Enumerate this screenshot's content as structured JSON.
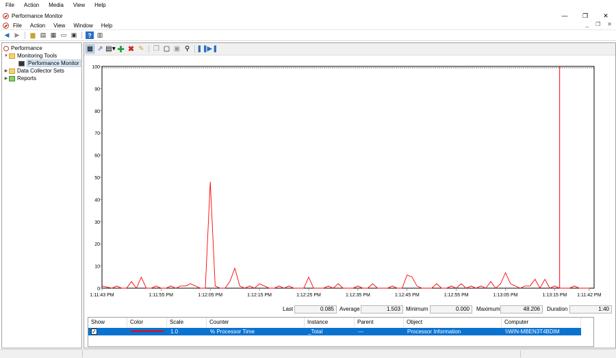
{
  "top_menu": [
    "File",
    "Action",
    "Media",
    "View",
    "Help"
  ],
  "window": {
    "title": "Performance Monitor",
    "controls": [
      "—",
      "❐",
      "✕"
    ]
  },
  "menu": [
    "File",
    "Action",
    "View",
    "Window",
    "Help"
  ],
  "mdi_controls": [
    "_",
    "❐",
    "✕"
  ],
  "tree": {
    "root": "Performance",
    "monitoring_tools": "Monitoring Tools",
    "performance_monitor": "Performance Monitor",
    "data_collector_sets": "Data Collector Sets",
    "reports": "Reports"
  },
  "accent_color": "#ff0000",
  "selection_color": "#0a72d0",
  "chart_data": {
    "type": "line",
    "title": "",
    "ylim": [
      0,
      100
    ],
    "y_ticks": [
      0,
      10,
      20,
      30,
      40,
      50,
      60,
      70,
      80,
      90,
      100
    ],
    "x_tick_labels": [
      "1:11:43 PM",
      "1:11:55 PM",
      "1:12:05 PM",
      "1:12:15 PM",
      "1:12:25 PM",
      "1:12:35 PM",
      "1:12:45 PM",
      "1:12:55 PM",
      "1:13:05 PM",
      "1:13:15 PM",
      "1:11:42 PM"
    ],
    "x_tick_positions_sec": [
      0,
      12,
      22,
      32,
      42,
      52,
      62,
      72,
      82,
      92,
      99
    ],
    "current_time_marker_sec": 93,
    "series": [
      {
        "color": "#ff0000",
        "x_sec": [
          0,
          2,
          3,
          4,
          5,
          6,
          7,
          8,
          9,
          10,
          11,
          12,
          13,
          14,
          15,
          16,
          17,
          18,
          19,
          20,
          21,
          22,
          23,
          24,
          25,
          26,
          27,
          28,
          29,
          30,
          31,
          32,
          33,
          34,
          35,
          36,
          37,
          38,
          39,
          40,
          41,
          42,
          43,
          44,
          45,
          46,
          47,
          48,
          49,
          50,
          51,
          52,
          53,
          54,
          55,
          56,
          57,
          58,
          59,
          60,
          61,
          62,
          63,
          64,
          65,
          66,
          67,
          68,
          69,
          70,
          71,
          72,
          73,
          74,
          75,
          76,
          77,
          78,
          79,
          80,
          81,
          82,
          83,
          84,
          85,
          86,
          87,
          88,
          89,
          90,
          91,
          92,
          93,
          94,
          95,
          96,
          97,
          98,
          99
        ],
        "y": [
          1,
          0,
          1,
          0,
          0,
          3,
          0,
          5,
          0,
          0,
          1,
          0,
          0,
          1,
          0,
          1,
          1,
          2,
          1,
          0,
          0,
          48,
          1,
          0,
          0,
          3,
          9,
          1,
          0,
          1,
          0,
          2,
          1,
          0,
          0,
          1,
          0,
          1,
          0,
          0,
          0,
          5,
          0,
          0,
          0,
          1,
          0,
          2,
          0,
          0,
          0,
          1,
          0,
          0,
          2,
          0,
          0,
          0,
          1,
          0,
          0,
          6,
          5,
          1,
          0,
          0,
          0,
          2,
          0,
          0,
          1,
          0,
          2,
          0,
          1,
          0,
          1,
          0,
          3,
          0,
          2,
          7,
          2,
          1,
          0,
          1,
          1,
          4,
          0,
          4,
          0,
          1,
          0,
          0,
          0,
          1,
          0,
          0,
          0
        ]
      }
    ]
  },
  "stats": {
    "last_label": "Last",
    "last": "0.085",
    "average_label": "Average",
    "average": "1.503",
    "minimum_label": "Minimum",
    "minimum": "0.000",
    "maximum_label": "Maximum",
    "maximum": "48.206",
    "duration_label": "Duration",
    "duration": "1:40"
  },
  "counter_table": {
    "headers": [
      "Show",
      "Color",
      "Scale",
      "Counter",
      "Instance",
      "Parent",
      "Object",
      "Computer"
    ],
    "rows": [
      {
        "show": "✓",
        "scale": "1.0",
        "counter": "% Processor Time",
        "instance": "_Total",
        "parent": "---",
        "object": "Processor Information",
        "computer": "\\\\WIN-MBEN3T4BDIM"
      }
    ]
  }
}
